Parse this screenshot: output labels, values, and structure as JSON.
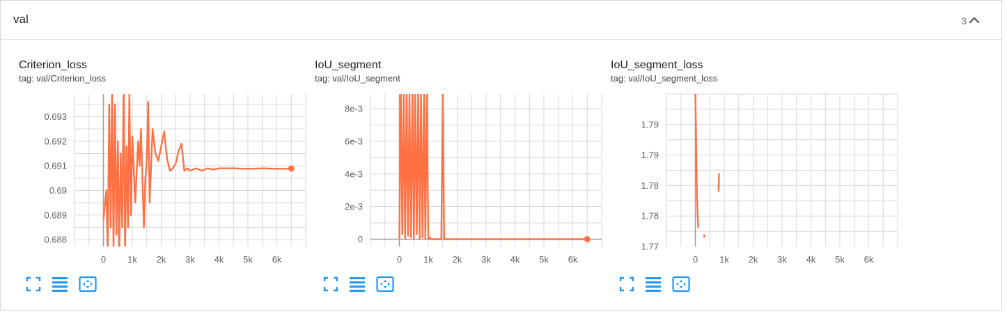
{
  "group": {
    "title": "val",
    "count": "3"
  },
  "icons": {
    "collapse": "chevron-up-icon",
    "fullscreen": "fullscreen-icon",
    "data_table": "data-table-icon",
    "fit_domain": "fit-domain-icon"
  },
  "colors": {
    "series": "#ff7043",
    "accent": "#2196f3",
    "grid": "#d7d7d7",
    "axis": "#9e9e9e"
  },
  "cards": [
    {
      "title": "Criterion_loss",
      "tag": "tag: val/Criterion_loss"
    },
    {
      "title": "IoU_segment",
      "tag": "tag: val/IoU_segment"
    },
    {
      "title": "IoU_segment_loss",
      "tag": "tag: val/IoU_segment_loss"
    }
  ],
  "chart_data": [
    {
      "type": "line",
      "title": "Criterion_loss",
      "xlim": [
        -1000,
        7000
      ],
      "ylim": [
        0.68772,
        0.69392
      ],
      "x_ticks": [
        "0",
        "1k",
        "2k",
        "3k",
        "4k",
        "5k",
        "6k"
      ],
      "y_ticks": [
        "0.693",
        "0.692",
        "0.691",
        "0.69",
        "0.689",
        "0.688"
      ],
      "series": [
        {
          "x": [
            0,
            100,
            150,
            200,
            250,
            300,
            350,
            400,
            450,
            500,
            550,
            600,
            650,
            700,
            750,
            800,
            850,
            900,
            950,
            1000,
            1100,
            1200,
            1250,
            1300,
            1400,
            1450,
            1500,
            1550,
            1600,
            1700,
            1800,
            1900,
            2000,
            2100,
            2200,
            2300,
            2400,
            2500,
            2600,
            2700,
            2800,
            2900,
            3000,
            3200,
            3400,
            3600,
            3800,
            4000,
            4500,
            5000,
            5500,
            6000,
            6500
          ],
          "y": [
            0.6888,
            0.69,
            0.6875,
            0.6935,
            0.6885,
            0.694,
            0.6875,
            0.6935,
            0.6882,
            0.692,
            0.6875,
            0.6915,
            0.6885,
            0.6945,
            0.6875,
            0.6918,
            0.6885,
            0.694,
            0.689,
            0.6922,
            0.6895,
            0.692,
            0.691,
            0.6925,
            0.6885,
            0.6905,
            0.6912,
            0.6936,
            0.6895,
            0.6925,
            0.6915,
            0.6912,
            0.6918,
            0.6924,
            0.6913,
            0.6908,
            0.6909,
            0.6911,
            0.6916,
            0.6919,
            0.6908,
            0.6909,
            0.6908,
            0.6909,
            0.6908,
            0.6909,
            0.69085,
            0.6909,
            0.6909,
            0.69088,
            0.6909,
            0.69088,
            0.69089
          ]
        }
      ]
    },
    {
      "type": "line",
      "title": "IoU_segment",
      "xlim": [
        -1000,
        7000
      ],
      "ylim": [
        -0.00045,
        0.0089
      ],
      "x_ticks": [
        "0",
        "1k",
        "2k",
        "3k",
        "4k",
        "5k",
        "6k"
      ],
      "y_ticks": [
        "8e-3",
        "6e-3",
        "4e-3",
        "2e-3",
        "0"
      ],
      "series": [
        {
          "x": [
            0,
            50,
            100,
            150,
            200,
            250,
            300,
            350,
            400,
            450,
            500,
            550,
            600,
            650,
            700,
            750,
            800,
            850,
            900,
            950,
            1000,
            1050,
            1100,
            1200,
            1300,
            1400,
            1450,
            1500,
            1550,
            1600,
            1700,
            1800,
            2000,
            3000,
            4000,
            5000,
            6000,
            6500
          ],
          "y": [
            0,
            0.009,
            0.0003,
            0.009,
            0,
            0.009,
            0.0002,
            0.009,
            0.0001,
            0.009,
            0,
            0.009,
            0.0003,
            0.009,
            0,
            0.009,
            0.0001,
            0.009,
            0,
            0.009,
            0,
            0.0001,
            0,
            0,
            0,
            0,
            0,
            0.009,
            0,
            0,
            0,
            0,
            0,
            0,
            0,
            0,
            0,
            0
          ]
        }
      ]
    },
    {
      "type": "line",
      "title": "IoU_segment_loss",
      "xlim": [
        -1000,
        7000
      ],
      "ylim": [
        1.7765,
        1.7815
      ],
      "x_ticks": [
        "0",
        "1k",
        "2k",
        "3k",
        "4k",
        "5k",
        "6k"
      ],
      "y_ticks": [
        "1.79",
        "1.79",
        "1.78",
        "1.78",
        "1.77"
      ],
      "series": [
        {
          "x": [
            0,
            20,
            40,
            60,
            80,
            100
          ],
          "y": [
            1.7815,
            1.7805,
            1.779,
            1.778,
            1.7775,
            1.7771
          ]
        },
        {
          "x": [
            300,
            320
          ],
          "y": [
            1.7768,
            1.7769
          ]
        },
        {
          "x": [
            800,
            820
          ],
          "y": [
            1.7783,
            1.7789
          ]
        }
      ]
    }
  ]
}
